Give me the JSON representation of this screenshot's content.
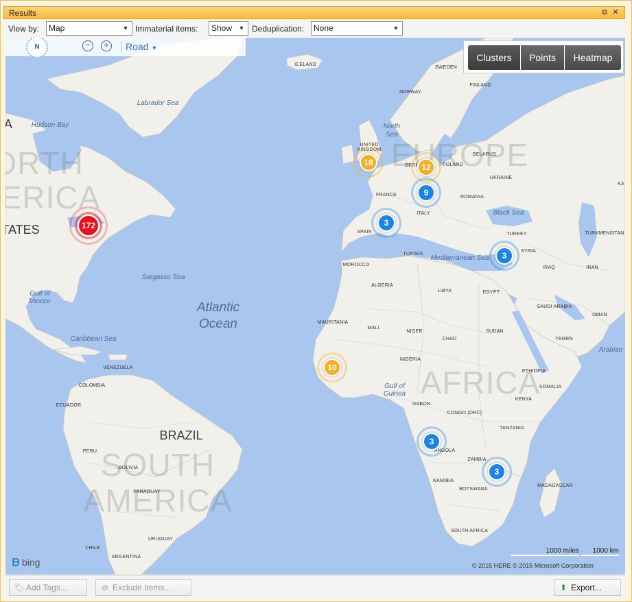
{
  "window": {
    "title": "Results",
    "restore_glyph": "⧉",
    "close_glyph": "✕"
  },
  "toolbar": {
    "view_by_label": "View by:",
    "view_by_value": "Map",
    "immaterial_label": "Immaterial items:",
    "immaterial_value": "Show",
    "dedup_label": "Deduplication:",
    "dedup_value": "None"
  },
  "map_nav": {
    "compass_label": "N",
    "zoom_out": "−",
    "zoom_in": "+",
    "map_style": "Road"
  },
  "modes": [
    {
      "label": "Clusters",
      "active": true
    },
    {
      "label": "Points",
      "active": false
    },
    {
      "label": "Heatmap",
      "active": false
    }
  ],
  "colors": {
    "red": "#e8101a",
    "orange": "#f4b020",
    "blue": "#1a84e8"
  },
  "clusters": [
    {
      "count": "172",
      "color": "red"
    },
    {
      "count": "18",
      "color": "orange"
    },
    {
      "count": "12",
      "color": "orange"
    },
    {
      "count": "9",
      "color": "blue"
    },
    {
      "count": "3",
      "color": "blue"
    },
    {
      "count": "3",
      "color": "blue"
    },
    {
      "count": "10",
      "color": "orange"
    },
    {
      "count": "3",
      "color": "blue"
    },
    {
      "count": "3",
      "color": "blue"
    }
  ],
  "labels": {
    "continents": [
      "NORTH",
      "AMERICA",
      "EUROPE",
      "AFRICA",
      "SOUTH",
      "AMERICA"
    ],
    "oceans": [
      "Atlantic",
      "Ocean"
    ],
    "seas": [
      "Labrador Sea",
      "Hudson Bay",
      "North",
      "Sea",
      "Black Sea",
      "Mediterranean Sea",
      "Sargasso Sea",
      "Gulf of",
      "Mexico",
      "Caribbean Sea",
      "Gulf of",
      "Guinea",
      "Arabian"
    ],
    "big_countries": [
      "BRAZIL",
      "TATES"
    ],
    "countries": [
      "ICELAND",
      "SWEDEN",
      "FINLAND",
      "NORWAY",
      "UNITED",
      "KINGDOM",
      "GERMANY",
      "POLAND",
      "BELARUS",
      "UKRAINE",
      "FRANCE",
      "ROMANIA",
      "ITALY",
      "SPAIN",
      "TURKEY",
      "TURKMENISTAN",
      "SYRIA",
      "IRAQ",
      "IRAN",
      "TUNISIA",
      "MOROCCO",
      "ALGERIA",
      "LIBYA",
      "EGYPT",
      "SAUDI ARABIA",
      "OMAN",
      "YEMEN",
      "MAURITANIA",
      "MALI",
      "NIGER",
      "CHAD",
      "SUDAN",
      "NIGERIA",
      "ETHIOPIA",
      "SOMALIA",
      "KENYA",
      "GABON",
      "CONGO (DRC)",
      "TANZANIA",
      "ANGOLA",
      "ZAMBIA",
      "NAMIBIA",
      "BOTSWANA",
      "MADAGASCAR",
      "SOUTH AFRICA",
      "VENEZUELA",
      "COLOMBIA",
      "ECUADOR",
      "PERU",
      "BOLIVIA",
      "PARAGUAY",
      "URUGUAY",
      "CHILE",
      "ARGENTINA",
      "KA",
      "A"
    ]
  },
  "scale": {
    "miles": "1000 miles",
    "km": "1000 km"
  },
  "copyright": "© 2015 HERE   © 2015 Microsoft Corporation",
  "bing": "bing",
  "bottom": {
    "add_tags": "Add Tags...",
    "exclude_items": "Exclude Items...",
    "export": "Export..."
  }
}
